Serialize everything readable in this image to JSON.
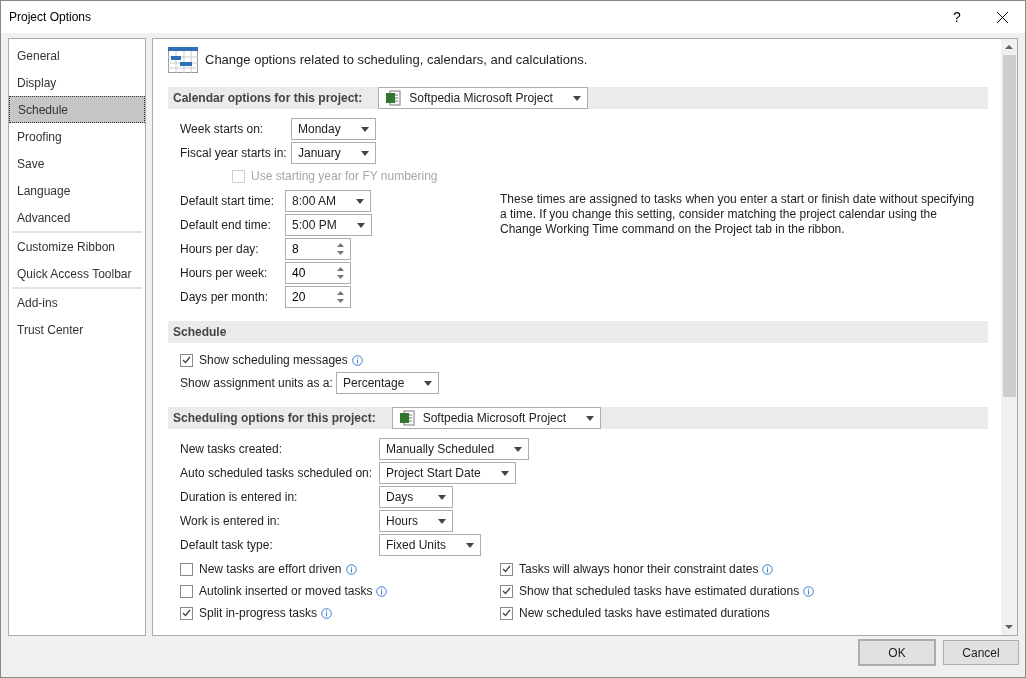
{
  "window": {
    "title": "Project Options",
    "help": "?"
  },
  "sidebar": {
    "groups": [
      [
        {
          "label": "General",
          "selected": false
        },
        {
          "label": "Display",
          "selected": false
        },
        {
          "label": "Schedule",
          "selected": true
        },
        {
          "label": "Proofing",
          "selected": false
        },
        {
          "label": "Save",
          "selected": false
        },
        {
          "label": "Language",
          "selected": false
        },
        {
          "label": "Advanced",
          "selected": false
        }
      ],
      [
        {
          "label": "Customize Ribbon",
          "selected": false
        },
        {
          "label": "Quick Access Toolbar",
          "selected": false
        }
      ],
      [
        {
          "label": "Add-ins",
          "selected": false
        },
        {
          "label": "Trust Center",
          "selected": false
        }
      ]
    ]
  },
  "intro": "Change options related to scheduling, calendars, and calculations.",
  "calendar_section": {
    "title": "Calendar options for this project:",
    "project": "Softpedia Microsoft Project",
    "fields_top": [
      {
        "label": "Week starts on:",
        "kind": "dropdown",
        "value": "Monday"
      },
      {
        "label": "Fiscal year starts in:",
        "kind": "dropdown",
        "value": "January"
      }
    ],
    "fy_checkbox": {
      "label": "Use starting year for FY numbering",
      "checked": false,
      "disabled": true
    },
    "fields_time": [
      {
        "label": "Default start time:",
        "kind": "dropdown",
        "value": "8:00 AM"
      },
      {
        "label": "Default end time:",
        "kind": "dropdown",
        "value": "5:00 PM"
      },
      {
        "label": "Hours per day:",
        "kind": "spinner",
        "value": "8"
      },
      {
        "label": "Hours per week:",
        "kind": "spinner",
        "value": "40"
      },
      {
        "label": "Days per month:",
        "kind": "spinner",
        "value": "20"
      }
    ],
    "note": "These times are assigned to tasks when you enter a start or finish date without specifying a time. If you change this setting, consider matching the project calendar using the Change Working Time command on the Project tab in the ribbon."
  },
  "schedule_section": {
    "title": "Schedule",
    "show_messages": {
      "label": "Show scheduling messages",
      "checked": true,
      "disabled": false,
      "info": true
    },
    "units": {
      "label": "Show assignment units as a:",
      "kind": "dropdown",
      "value": "Percentage"
    }
  },
  "scheduling_section": {
    "title": "Scheduling options for this project:",
    "project": "Softpedia Microsoft Project",
    "fields": [
      {
        "label": "New tasks created:",
        "kind": "dropdown",
        "value": "Manually Scheduled"
      },
      {
        "label": "Auto scheduled tasks scheduled on:",
        "kind": "dropdown",
        "value": "Project Start Date"
      },
      {
        "label": "Duration is entered in:",
        "kind": "dropdown",
        "value": "Days"
      },
      {
        "label": "Work is entered in:",
        "kind": "dropdown",
        "value": "Hours"
      },
      {
        "label": "Default task type:",
        "kind": "dropdown",
        "value": "Fixed Units"
      }
    ],
    "checks_left": [
      {
        "label": "New tasks are effort driven",
        "checked": false,
        "disabled": false,
        "info": true
      },
      {
        "label": "Autolink inserted or moved tasks",
        "checked": false,
        "disabled": false,
        "info": true
      },
      {
        "label": "Split in-progress tasks",
        "checked": true,
        "disabled": false,
        "info": true
      }
    ],
    "checks_right": [
      {
        "label": "Tasks will always honor their constraint dates",
        "checked": true,
        "disabled": false,
        "info": true
      },
      {
        "label": "Show that scheduled tasks have estimated durations",
        "checked": true,
        "disabled": false,
        "info": true
      },
      {
        "label": "New scheduled tasks have estimated durations",
        "checked": true,
        "disabled": false,
        "info": false
      }
    ]
  },
  "buttons": [
    "OK",
    "Cancel"
  ]
}
